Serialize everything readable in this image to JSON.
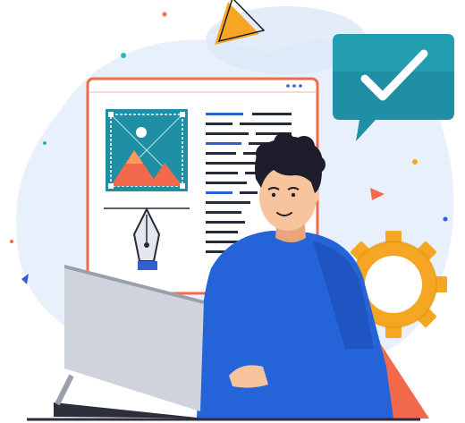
{
  "illustration": {
    "subject": "person-at-laptop-editing-layout",
    "icons": [
      "image-icon",
      "pen-tool-icon",
      "checkmark-bubble-icon",
      "gear-icon",
      "triangle-decoration",
      "dot-decoration"
    ],
    "palette": {
      "blob": "#e8f1fb",
      "blob_dark": "#dbe8f7",
      "window_border": "#f26a4b",
      "window_fill": "#ffffff",
      "teal": "#1f8fa3",
      "teal_light": "#2bb6c8",
      "orange": "#f26a4b",
      "orange_light": "#ff9a5c",
      "yellow": "#f6a623",
      "gear": "#f5a623",
      "shirt": "#2563d8",
      "shirt_dark": "#1a4ab0",
      "skin": "#f8c49d",
      "skin_shadow": "#e9a57e",
      "hair": "#1d1d2b",
      "laptop": "#cfd3db",
      "laptop_dark": "#9aa0ab",
      "text_dark": "#262b38",
      "text_blue": "#2f5fd0",
      "ink": "#2b2f3a"
    }
  }
}
